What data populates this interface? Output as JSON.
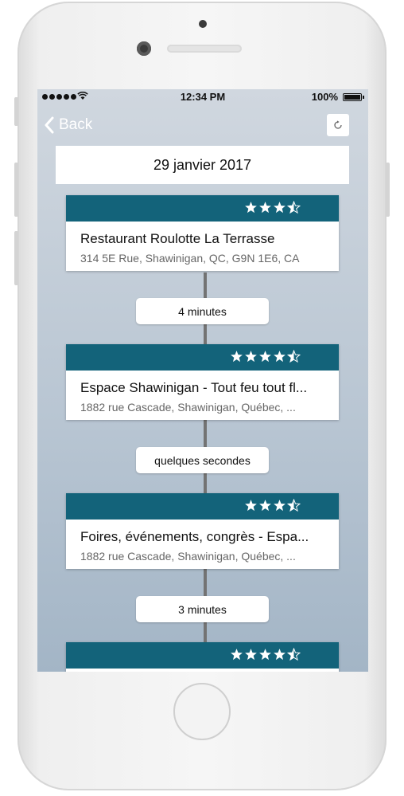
{
  "status_bar": {
    "time": "12:34 PM",
    "battery": "100%"
  },
  "nav": {
    "back_label": "Back",
    "refresh_icon": "refresh-icon"
  },
  "date": "29 janvier 2017",
  "colors": {
    "card_header": "#13637a",
    "background_top": "#d0d7df",
    "background_bottom": "#a3b5c6"
  },
  "places": [
    {
      "name": "Restaurant Roulotte La Terrasse",
      "address": "314 5E Rue, Shawinigan, QC, G9N 1E6, CA",
      "rating": 3.5
    },
    {
      "name": "Espace Shawinigan - Tout feu tout fl...",
      "address": "1882 rue Cascade, Shawinigan, Québec, ...",
      "rating": 4.5
    },
    {
      "name": "Foires, événements, congrès - Espa...",
      "address": "1882 rue Cascade, Shawinigan, Québec, ...",
      "rating": 3.5
    },
    {
      "name": "",
      "address": "",
      "rating": 4.5
    }
  ],
  "durations": [
    "4 minutes",
    "quelques secondes",
    "3 minutes"
  ]
}
